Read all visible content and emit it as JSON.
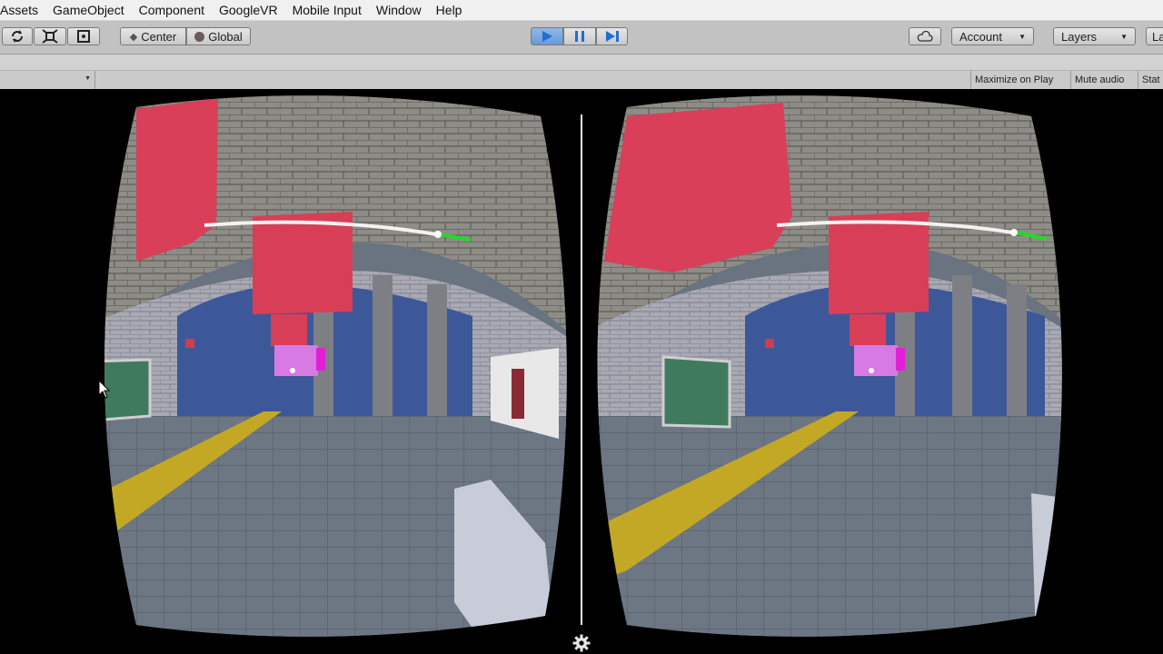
{
  "menu": [
    "Assets",
    "GameObject",
    "Component",
    "GoogleVR",
    "Mobile Input",
    "Window",
    "Help"
  ],
  "toolbar": {
    "pivot_center_label": "Center",
    "pivot_global_label": "Global",
    "account_label": "Account",
    "layers_label": "Layers",
    "layout_label": "La",
    "play_state": "playing",
    "accent": "#2a7fd8"
  },
  "game_view": {
    "aspect_dropdown_value": "",
    "maximize_on_play": "Maximize on Play",
    "mute_audio": "Mute audio",
    "stats": "Stat"
  },
  "scene": {
    "left_poster_text": "",
    "right_poster_text": "",
    "settings_icon": "gear-icon"
  }
}
